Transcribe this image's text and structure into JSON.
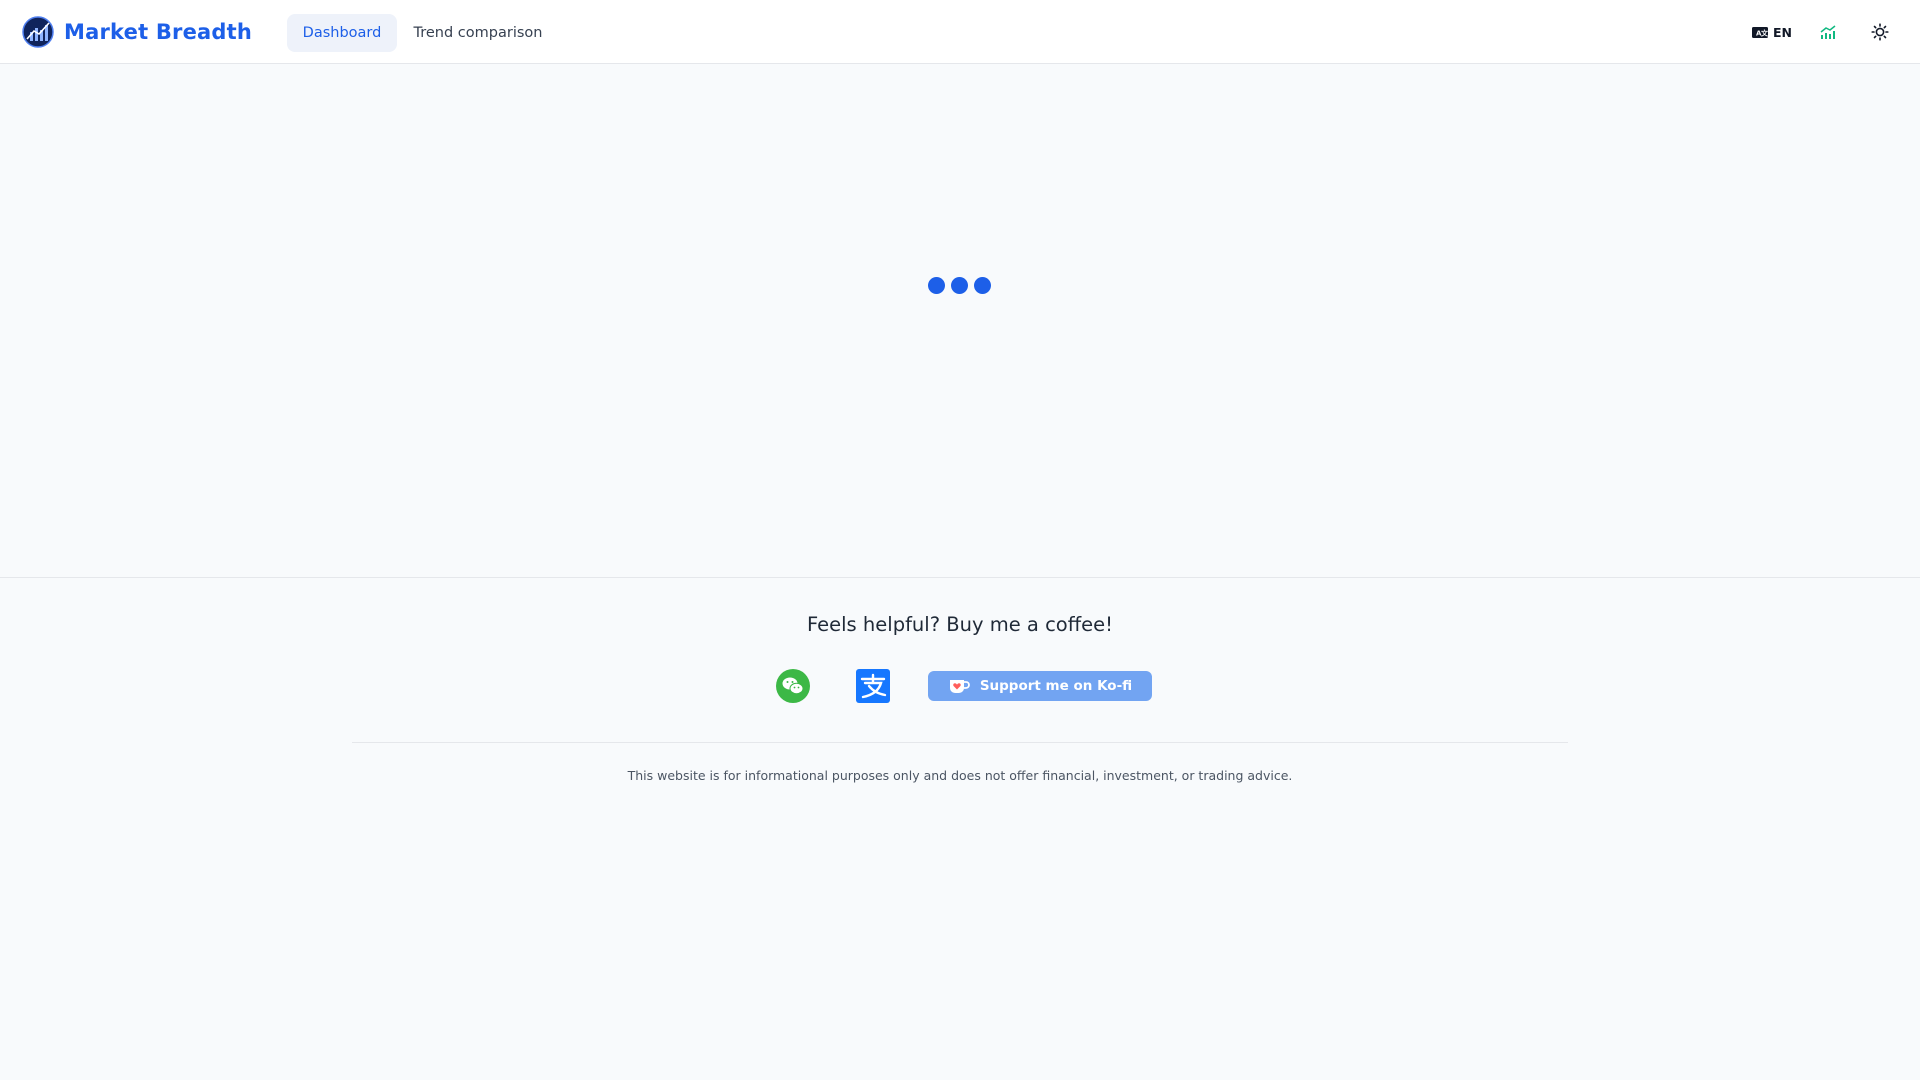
{
  "header": {
    "app_title": "Market Breadth",
    "tabs": [
      {
        "label": "Dashboard",
        "active": true
      },
      {
        "label": "Trend comparison",
        "active": false
      }
    ],
    "language": {
      "code": "EN",
      "icon": "language-icon"
    },
    "chart_icon": "chart-icon",
    "theme_icon": "sun-icon"
  },
  "loading": {
    "dots": 3
  },
  "footer": {
    "heading": "Feels helpful? Buy me a coffee!",
    "wechat_icon": "wechat-icon",
    "alipay_icon": "alipay-icon",
    "kofi_label": "Support me on Ko-fi",
    "disclaimer": "This website is for informational purposes only and does not offer financial, investment, or trading advice."
  },
  "colors": {
    "brand": "#1d5fe8",
    "active_tab_bg": "#eef2fa",
    "kofi_button": "#72a4f2",
    "wechat": "#3cb846",
    "alipay": "#1677ff",
    "chart_icon": "#10b981",
    "page_bg": "#f8fafc"
  }
}
